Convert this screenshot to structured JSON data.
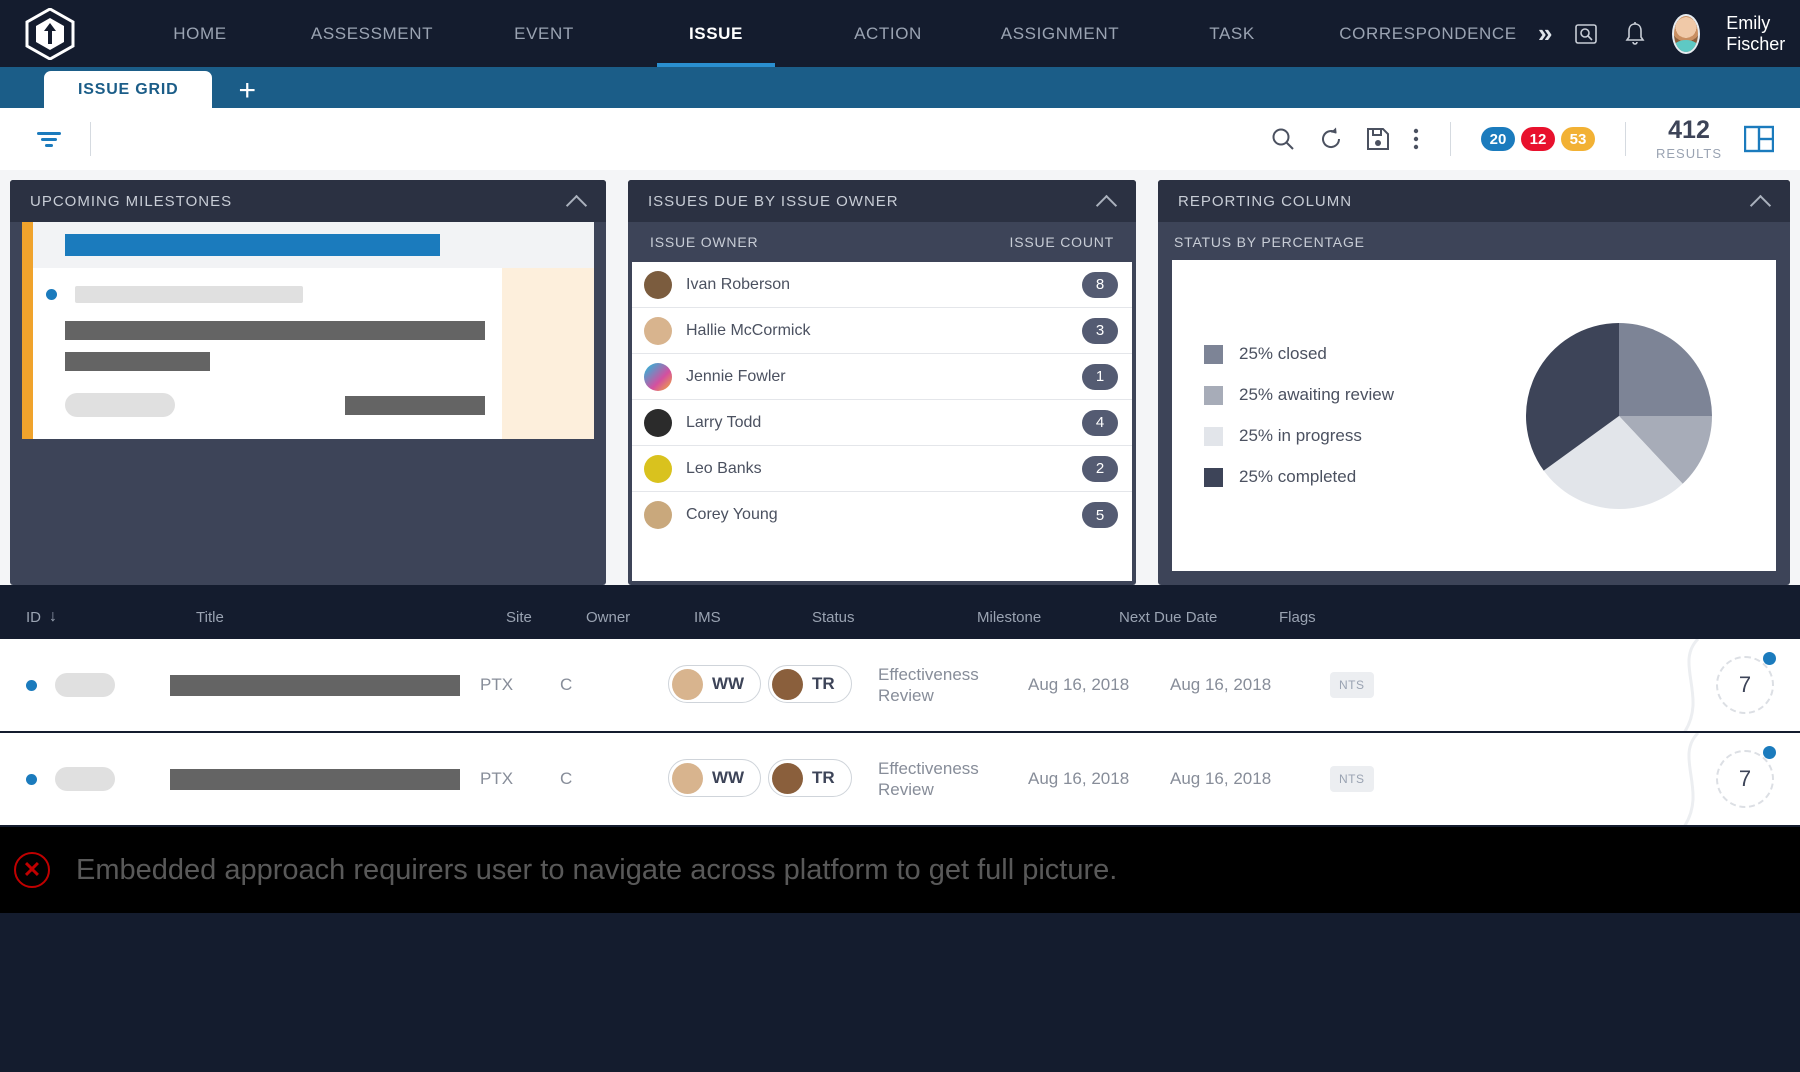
{
  "nav": {
    "logo_icon": "hexagon-arrow-logo",
    "items": [
      {
        "label": "HOME",
        "active": false
      },
      {
        "label": "ASSESSMENT",
        "active": false
      },
      {
        "label": "EVENT",
        "active": false
      },
      {
        "label": "ISSUE",
        "active": true
      },
      {
        "label": "ACTION",
        "active": false
      },
      {
        "label": "ASSIGNMENT",
        "active": false
      },
      {
        "label": "TASK",
        "active": false
      },
      {
        "label": "CORRESPONDENCE",
        "active": false
      }
    ],
    "overflow_icon": "double-chevron-right-icon",
    "search_icon": "search-box-icon",
    "bell_icon": "notification-bell-icon",
    "user_name": "Emily Fischer"
  },
  "tabs": {
    "items": [
      {
        "label": "ISSUE GRID",
        "active": true
      }
    ],
    "add_label": "+"
  },
  "toolbar": {
    "filter_icon": "filter-funnel-icon",
    "search_icon": "search-icon",
    "refresh_icon": "refresh-icon",
    "save_icon": "save-disk-icon",
    "more_icon": "more-vertical-icon",
    "badges": [
      {
        "value": "20",
        "color": "#1b7bbd"
      },
      {
        "value": "12",
        "color": "#e8112d"
      },
      {
        "value": "53",
        "color": "#f2b134"
      }
    ],
    "results_count": "412",
    "results_label": "RESULTS",
    "layout_icon": "panel-layout-icon"
  },
  "widgets": {
    "milestones": {
      "title": "UPCOMING MILESTONES",
      "collapse_icon": "chevron-up-icon"
    },
    "owners": {
      "title": "ISSUES DUE BY ISSUE OWNER",
      "collapse_icon": "chevron-up-icon",
      "col_owner": "ISSUE OWNER",
      "col_count": "ISSUE COUNT",
      "rows": [
        {
          "name": "Ivan Roberson",
          "count": "8",
          "avatar": "#7b5c3e"
        },
        {
          "name": "Hallie McCormick",
          "count": "3",
          "avatar": "#d8b48e"
        },
        {
          "name": "Jennie Fowler",
          "count": "1",
          "avatar": "#d44fa0"
        },
        {
          "name": "Larry Todd",
          "count": "4",
          "avatar": "#2b2b2b"
        },
        {
          "name": "Leo Banks",
          "count": "2",
          "avatar": "#d9c21e"
        },
        {
          "name": "Corey Young",
          "count": "5",
          "avatar": "#c9a87c"
        }
      ]
    },
    "reporting": {
      "title": "REPORTING COLUMN",
      "collapse_icon": "chevron-up-icon",
      "subtitle": "STATUS BY PERCENTAGE"
    }
  },
  "chart_data": {
    "type": "pie",
    "title": "STATUS BY PERCENTAGE",
    "labels": [
      "25% closed",
      "25% awaiting review",
      "25% in progress",
      "25% completed"
    ],
    "categories": [
      "closed",
      "awaiting review",
      "in progress",
      "completed"
    ],
    "values": [
      25,
      25,
      25,
      25
    ],
    "rendered_fractions": [
      0.25,
      0.13,
      0.27,
      0.35
    ],
    "colors": [
      "#7d8496",
      "#a7acb8",
      "#e2e5ea",
      "#3d4458"
    ],
    "legend": "left",
    "grid": false
  },
  "grid": {
    "columns": [
      "ID",
      "Title",
      "Site",
      "Owner",
      "IMS",
      "Status",
      "Milestone",
      "Next Due Date",
      "Flags"
    ],
    "sort_icon": "sort-descending-arrow-icon",
    "rows": [
      {
        "id_redacted": true,
        "title_redacted": true,
        "site": "PTX",
        "owner": "C",
        "chip1": "WW",
        "chip2": "TR",
        "status": "Effectiveness Review",
        "milestone": "Aug 16, 2018",
        "next_due_date": "Aug 16, 2018",
        "flag": "NTS",
        "ring_value": "7"
      },
      {
        "id_redacted": true,
        "title_redacted": true,
        "site": "PTX",
        "owner": "C",
        "chip1": "WW",
        "chip2": "TR",
        "status": "Effectiveness Review",
        "milestone": "Aug 16, 2018",
        "next_due_date": "Aug 16, 2018",
        "flag": "NTS",
        "ring_value": "7"
      }
    ]
  },
  "caption": {
    "icon": "red-x-circle-icon",
    "icon_glyph": "✕",
    "text": "Embedded approach requirers user to navigate across platform to get full picture."
  }
}
